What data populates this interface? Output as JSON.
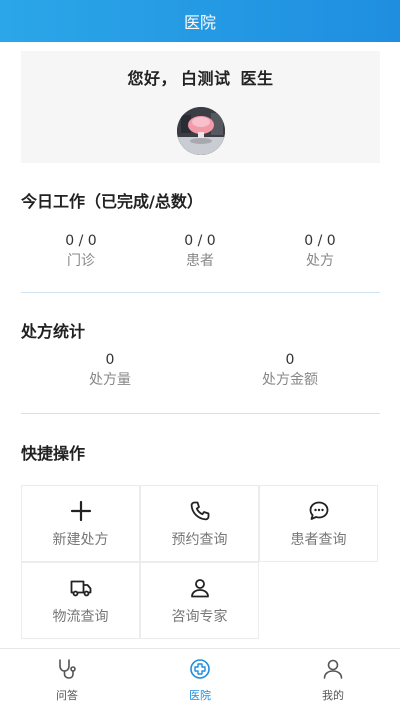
{
  "header": {
    "title": "医院"
  },
  "greeting": {
    "hello": "您好，",
    "name": "白测试",
    "role": "医生"
  },
  "today_work": {
    "title": "今日工作（已完成/总数）",
    "items": [
      {
        "value": "0 / 0",
        "label": "门诊"
      },
      {
        "value": "0 / 0",
        "label": "患者"
      },
      {
        "value": "0 / 0",
        "label": "处方"
      }
    ]
  },
  "prescription_stats": {
    "title": "处方统计",
    "items": [
      {
        "value": "0",
        "label": "处方量"
      },
      {
        "value": "0",
        "label": "处方金额"
      }
    ]
  },
  "quick_actions": {
    "title": "快捷操作",
    "items": [
      {
        "label": "新建处方",
        "icon": "plus-icon"
      },
      {
        "label": "预约查询",
        "icon": "phone-icon"
      },
      {
        "label": "患者查询",
        "icon": "chat-icon"
      },
      {
        "label": "物流查询",
        "icon": "truck-icon"
      },
      {
        "label": "咨询专家",
        "icon": "user-icon"
      }
    ]
  },
  "tabbar": {
    "items": [
      {
        "label": "问答",
        "icon": "stethoscope-icon",
        "active": false
      },
      {
        "label": "医院",
        "icon": "hospital-cross-icon",
        "active": true
      },
      {
        "label": "我的",
        "icon": "profile-icon",
        "active": false
      }
    ],
    "active_color": "#1f8ee0"
  },
  "colors": {
    "header_start": "#2ba6e8",
    "header_end": "#1f8ee0",
    "accent": "#1f8ee0"
  }
}
